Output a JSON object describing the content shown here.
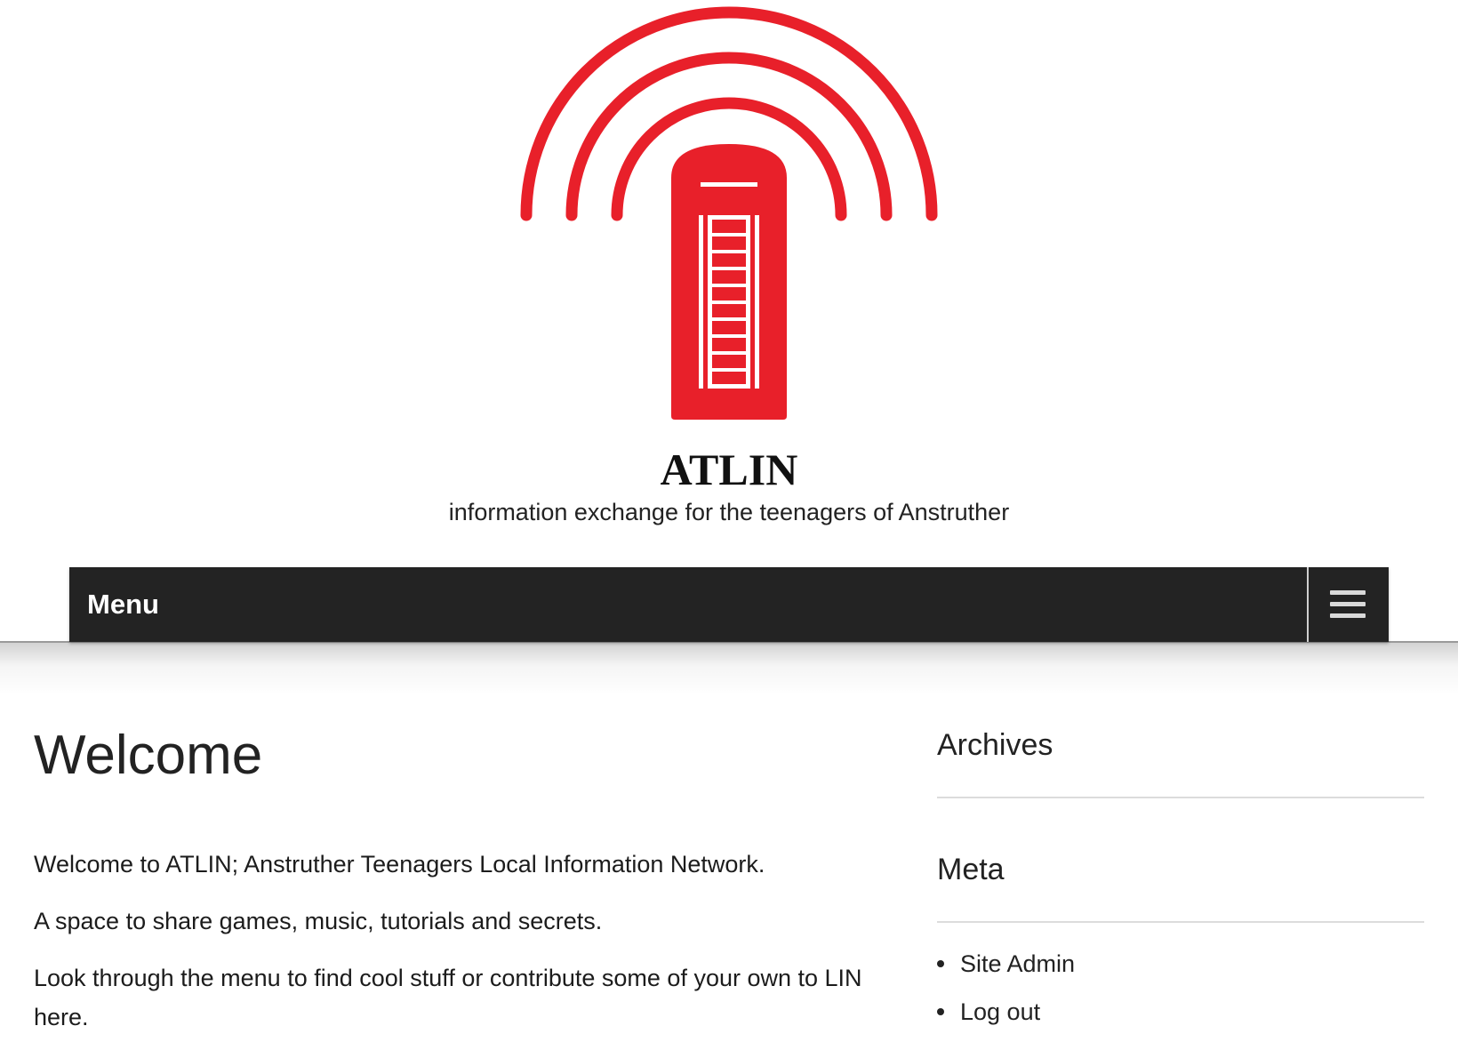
{
  "site": {
    "title": "ATLIN",
    "tagline": "information exchange for the teenagers of Anstruther",
    "logo_icon": "red-telephone-box-broadcast-icon",
    "brand_color": "#e8202a"
  },
  "nav": {
    "menu_label": "Menu",
    "toggle_icon": "hamburger-menu-icon",
    "bar_color": "#232323"
  },
  "main": {
    "title": "Welcome",
    "paragraphs": [
      "Welcome to ATLIN; Anstruther Teenagers Local Information Network.",
      "A space to share games, music, tutorials and secrets.",
      "Look through the menu to find cool stuff or contribute some of your own to LIN here."
    ]
  },
  "sidebar": {
    "archives": {
      "title": "Archives"
    },
    "meta": {
      "title": "Meta",
      "links": [
        "Site Admin",
        "Log out"
      ]
    }
  }
}
